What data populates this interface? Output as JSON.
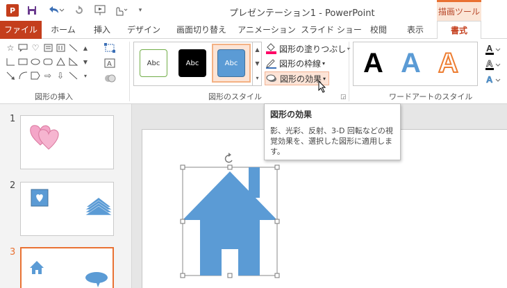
{
  "titlebar": {
    "title": "プレゼンテーション1 - PowerPoint",
    "contextual_tab_group": "描画ツール",
    "logo_label": "P"
  },
  "tabs": [
    {
      "label": "ファイル"
    },
    {
      "label": "ホーム"
    },
    {
      "label": "挿入"
    },
    {
      "label": "デザイン"
    },
    {
      "label": "画面切り替え"
    },
    {
      "label": "アニメーション"
    },
    {
      "label": "スライド ショー"
    },
    {
      "label": "校閲"
    },
    {
      "label": "表示"
    },
    {
      "label": "書式"
    }
  ],
  "ribbon": {
    "groups": {
      "insert_shapes": "図形の挿入",
      "shape_styles": "図形のスタイル",
      "wordart_styles": "ワードアートのスタイル"
    },
    "style_thumbs": [
      "Abc",
      "Abc",
      "Abc"
    ],
    "commands": {
      "fill": "図形の塗りつぶし",
      "outline": "図形の枠線",
      "effects": "図形の効果"
    },
    "wordart_letters": [
      "A",
      "A",
      "A"
    ]
  },
  "tooltip": {
    "title": "図形の効果",
    "body": "影、光彩、反射、3-D 回転などの視覚効果を、選択した図形に適用します。"
  },
  "slides": [
    {
      "number": "1"
    },
    {
      "number": "2"
    },
    {
      "number": "3"
    }
  ],
  "colors": {
    "accent": "#c43e1c",
    "contextual": "#e97132",
    "shape_fill": "#5b9bd5",
    "heart_fill": "#f4a6c8"
  }
}
